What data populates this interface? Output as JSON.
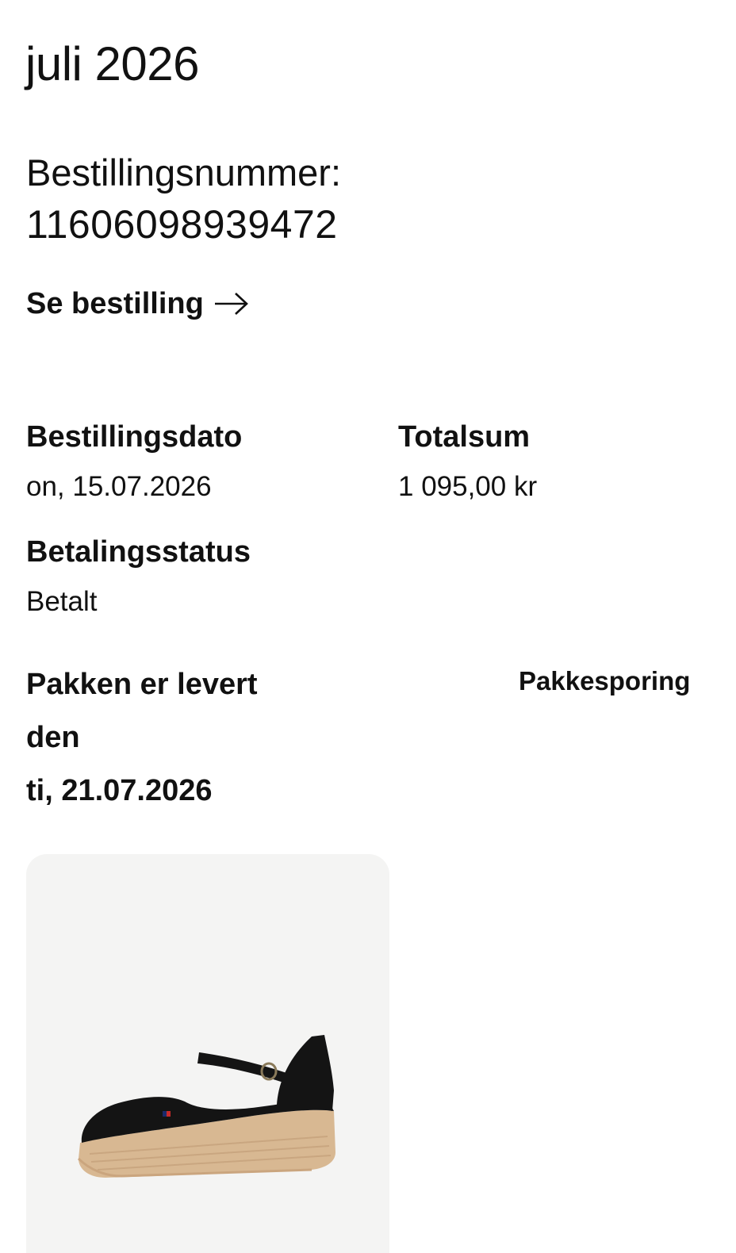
{
  "order_group": {
    "month": "juli 2026"
  },
  "order": {
    "number_label": "Bestillingsnummer:",
    "number_value": "11606098939472",
    "view_link_label": "Se bestilling",
    "order_date_label": "Bestillingsdato",
    "order_date_value": "on, 15.07.2026",
    "total_label": "Totalsum",
    "total_value": "1 095,00 kr",
    "payment_status_label": "Betalingsstatus",
    "payment_status_value": "Betalt",
    "delivery_line_1": "Pakken er levert",
    "delivery_line_2": "den",
    "delivery_line_3": "ti, 21.07.2026",
    "tracking_link_label": "Pakkesporing"
  },
  "product": {
    "image_icon": "espadrille-wedge-sandal-image",
    "shoe_color": "#141414",
    "sole_color": "#d8b892"
  },
  "icons": {
    "view_link_icon": "arrow-right-icon"
  }
}
